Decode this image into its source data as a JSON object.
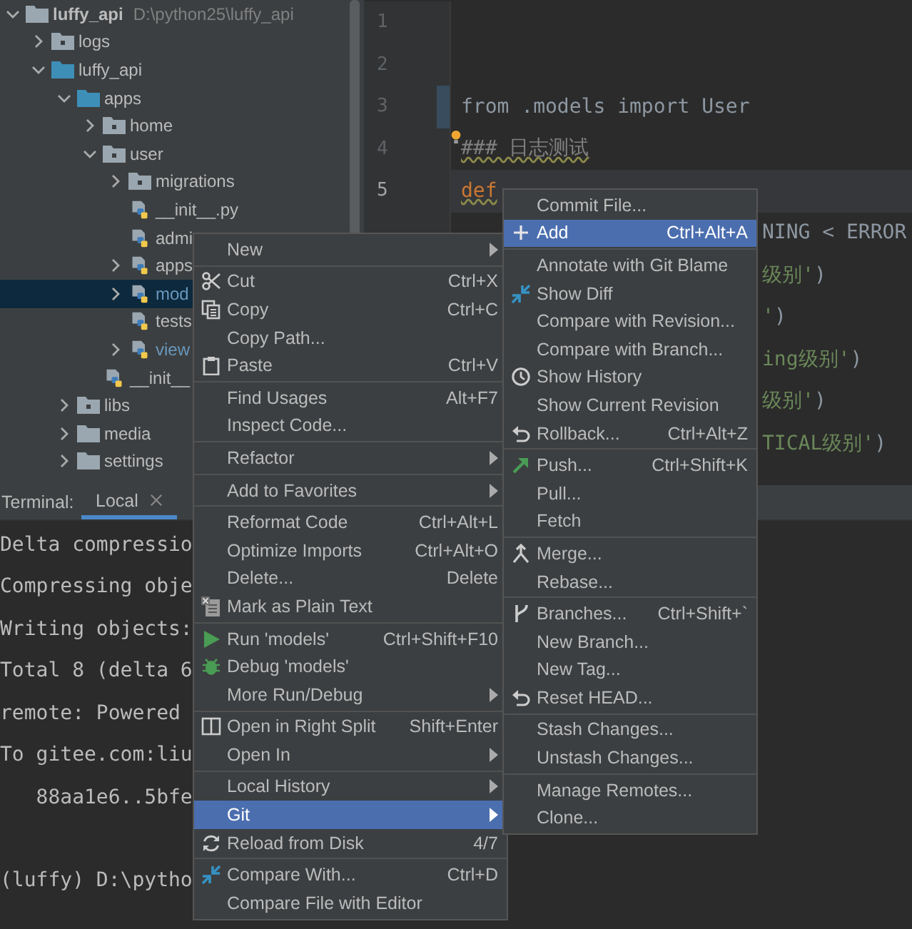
{
  "project_tree": {
    "items": [
      {
        "label": "luffy_api",
        "path": "D:\\python25\\luffy_api",
        "kind": "folder",
        "expanded": true,
        "selected": false,
        "modified": false,
        "children": [
          {
            "label": "logs",
            "kind": "package",
            "expanded": false,
            "selected": false,
            "modified": false
          },
          {
            "label": "luffy_api",
            "kind": "source",
            "expanded": true,
            "selected": false,
            "modified": false,
            "children": [
              {
                "label": "apps",
                "kind": "source",
                "expanded": true,
                "selected": false,
                "modified": false,
                "children": [
                  {
                    "label": "home",
                    "kind": "package",
                    "expanded": false,
                    "selected": false,
                    "modified": false
                  },
                  {
                    "label": "user",
                    "kind": "package",
                    "expanded": true,
                    "selected": false,
                    "modified": false,
                    "children": [
                      {
                        "label": "migrations",
                        "kind": "package",
                        "expanded": false,
                        "selected": false,
                        "modified": false
                      },
                      {
                        "label": "__init__.py",
                        "kind": "python",
                        "selected": false,
                        "modified": false
                      },
                      {
                        "label": "admi",
                        "kind": "python",
                        "selected": false,
                        "modified": false
                      },
                      {
                        "label": "apps",
                        "kind": "module",
                        "expanded": false,
                        "selected": false,
                        "modified": false
                      },
                      {
                        "label": "mod",
                        "kind": "module",
                        "expanded": false,
                        "selected": true,
                        "modified": true
                      },
                      {
                        "label": "tests",
                        "kind": "python",
                        "selected": false,
                        "modified": false
                      },
                      {
                        "label": "view",
                        "kind": "module",
                        "expanded": false,
                        "selected": false,
                        "modified": true
                      }
                    ]
                  },
                  {
                    "label": "__init__",
                    "kind": "python",
                    "selected": false,
                    "modified": false
                  }
                ]
              },
              {
                "label": "libs",
                "kind": "package",
                "expanded": false,
                "selected": false,
                "modified": false
              },
              {
                "label": "media",
                "kind": "folder",
                "expanded": false,
                "selected": false,
                "modified": false
              },
              {
                "label": "settings",
                "kind": "folder",
                "expanded": false,
                "selected": false,
                "modified": false
              }
            ]
          }
        ]
      }
    ]
  },
  "editor": {
    "lines": [
      {
        "number": "1",
        "current": false,
        "changed": false,
        "bulb": false
      },
      {
        "number": "2",
        "current": false,
        "changed": false,
        "bulb": false
      },
      {
        "number": "3",
        "current": false,
        "changed": true,
        "bulb": false,
        "tokens": [
          {
            "text": "from .models import User",
            "kind": "plain"
          }
        ]
      },
      {
        "number": "4",
        "current": false,
        "changed": false,
        "bulb": true,
        "tokens": [
          {
            "text": "### 日志测试",
            "kind": "comment"
          }
        ]
      },
      {
        "number": "5",
        "current": true,
        "changed": false,
        "bulb": false,
        "tokens": [
          {
            "text": "def",
            "kind": "keyword"
          }
        ]
      }
    ],
    "tail_lines": [
      {
        "tokens": [
          {
            "text": "NING < ERROR",
            "kind": "plain"
          }
        ]
      },
      {
        "tokens": [
          {
            "text": "级别'",
            "kind": "string"
          },
          {
            "text": ")",
            "kind": "plain"
          }
        ]
      },
      {
        "tokens": [
          {
            "text": "'",
            "kind": "string"
          },
          {
            "text": ")",
            "kind": "plain"
          }
        ]
      },
      {
        "tokens": [
          {
            "text": "ing级别'",
            "kind": "string"
          },
          {
            "text": ")",
            "kind": "plain"
          }
        ]
      },
      {
        "tokens": [
          {
            "text": "级别'",
            "kind": "string"
          },
          {
            "text": ")",
            "kind": "plain"
          }
        ]
      },
      {
        "tokens": [
          {
            "text": "TICAL级别'",
            "kind": "string"
          },
          {
            "text": ")",
            "kind": "plain"
          }
        ]
      }
    ]
  },
  "terminal": {
    "title": "Terminal:",
    "tabs": [
      {
        "label": "Local",
        "selected": true
      }
    ],
    "lines": [
      "Delta compressio",
      "Compressing obje",
      "Writing objects:",
      "Total 8 (delta 6",
      "remote: Powered",
      "To gitee.com:liu",
      "   88aa1e6..5bfe"
    ],
    "prompt": "(luffy) D:\\pytho"
  },
  "context_menu": {
    "groups": [
      [
        {
          "label": "New",
          "submenu": true,
          "selected": false
        }
      ],
      [
        {
          "label": "Cut",
          "shortcut": "Ctrl+X",
          "submenu": false,
          "selected": false
        },
        {
          "label": "Copy",
          "shortcut": "Ctrl+C",
          "submenu": false,
          "selected": false
        },
        {
          "label": "Copy Path...",
          "submenu": false,
          "selected": false
        },
        {
          "label": "Paste",
          "shortcut": "Ctrl+V",
          "submenu": false,
          "selected": false
        }
      ],
      [
        {
          "label": "Find Usages",
          "shortcut": "Alt+F7",
          "submenu": false,
          "selected": false
        },
        {
          "label": "Inspect Code...",
          "submenu": false,
          "selected": false
        }
      ],
      [
        {
          "label": "Refactor",
          "submenu": true,
          "selected": false
        }
      ],
      [
        {
          "label": "Add to Favorites",
          "submenu": true,
          "selected": false
        }
      ],
      [
        {
          "label": "Reformat Code",
          "shortcut": "Ctrl+Alt+L",
          "submenu": false,
          "selected": false
        },
        {
          "label": "Optimize Imports",
          "shortcut": "Ctrl+Alt+O",
          "submenu": false,
          "selected": false
        },
        {
          "label": "Delete...",
          "shortcut": "Delete",
          "submenu": false,
          "selected": false
        },
        {
          "label": "Mark as Plain Text",
          "submenu": false,
          "selected": false
        }
      ],
      [
        {
          "label": "Run 'models'",
          "shortcut": "Ctrl+Shift+F10",
          "submenu": false,
          "selected": false
        },
        {
          "label": "Debug 'models'",
          "submenu": false,
          "selected": false
        },
        {
          "label": "More Run/Debug",
          "submenu": true,
          "selected": false
        }
      ],
      [
        {
          "label": "Open in Right Split",
          "shortcut": "Shift+Enter",
          "submenu": false,
          "selected": false
        },
        {
          "label": "Open In",
          "submenu": true,
          "selected": false
        }
      ],
      [
        {
          "label": "Local History",
          "submenu": true,
          "selected": false
        },
        {
          "label": "Git",
          "submenu": true,
          "selected": true
        },
        {
          "label": "Reload from Disk",
          "shortcut": "4/7",
          "submenu": false,
          "selected": false
        }
      ],
      [
        {
          "label": "Compare With...",
          "shortcut": "Ctrl+D",
          "submenu": false,
          "selected": false
        },
        {
          "label": "Compare File with Editor",
          "submenu": false,
          "selected": false
        }
      ]
    ]
  },
  "git_submenu": {
    "groups": [
      [
        {
          "label": "Commit File...",
          "submenu": false,
          "selected": false
        },
        {
          "label": "Add",
          "shortcut": "Ctrl+Alt+A",
          "submenu": false,
          "selected": true
        }
      ],
      [
        {
          "label": "Annotate with Git Blame",
          "submenu": false,
          "selected": false
        },
        {
          "label": "Show Diff",
          "submenu": false,
          "selected": false
        },
        {
          "label": "Compare with Revision...",
          "submenu": false,
          "selected": false
        },
        {
          "label": "Compare with Branch...",
          "submenu": false,
          "selected": false
        },
        {
          "label": "Show History",
          "submenu": false,
          "selected": false
        },
        {
          "label": "Show Current Revision",
          "submenu": false,
          "selected": false
        },
        {
          "label": "Rollback...",
          "shortcut": "Ctrl+Alt+Z",
          "submenu": false,
          "selected": false
        }
      ],
      [
        {
          "label": "Push...",
          "shortcut": "Ctrl+Shift+K",
          "submenu": false,
          "selected": false
        },
        {
          "label": "Pull...",
          "submenu": false,
          "selected": false
        },
        {
          "label": "Fetch",
          "submenu": false,
          "selected": false
        }
      ],
      [
        {
          "label": "Merge...",
          "submenu": false,
          "selected": false
        },
        {
          "label": "Rebase...",
          "submenu": false,
          "selected": false
        }
      ],
      [
        {
          "label": "Branches...",
          "shortcut": "Ctrl+Shift+`",
          "submenu": false,
          "selected": false
        },
        {
          "label": "New Branch...",
          "submenu": false,
          "selected": false
        },
        {
          "label": "New Tag...",
          "submenu": false,
          "selected": false
        },
        {
          "label": "Reset HEAD...",
          "submenu": false,
          "selected": false
        }
      ],
      [
        {
          "label": "Stash Changes...",
          "submenu": false,
          "selected": false
        },
        {
          "label": "Unstash Changes...",
          "submenu": false,
          "selected": false
        }
      ],
      [
        {
          "label": "Manage Remotes...",
          "submenu": false,
          "selected": false
        },
        {
          "label": "Clone...",
          "submenu": false,
          "selected": false
        }
      ]
    ]
  }
}
